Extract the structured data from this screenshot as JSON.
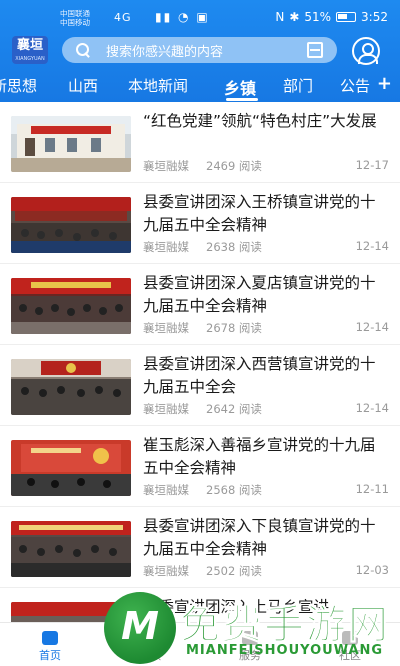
{
  "status_bar": {
    "carrier_line1": "中国联通",
    "carrier_line2": "中国移动",
    "network": "4G",
    "icons": [
      "signal-icon",
      "wifi-icon",
      "message-icon"
    ],
    "battery": "51%",
    "time": "3:52"
  },
  "header": {
    "logo_text": "襄垣",
    "logo_sub": "XIANGYUAN",
    "search_placeholder": "搜索你感兴趣的内容",
    "brand_color": "#1778e3"
  },
  "tabs": [
    {
      "label": "新思想"
    },
    {
      "label": "山西"
    },
    {
      "label": "本地新闻"
    },
    {
      "label": "乡镇",
      "active": true
    },
    {
      "label": "部门"
    },
    {
      "label": "公告"
    }
  ],
  "tab_plus": "+",
  "news": [
    {
      "title": "“红色党建”领航“特色村庄”大发展",
      "source": "襄垣融媒",
      "reads": "2469 阅读",
      "date": "12-17"
    },
    {
      "title": "县委宣讲团深入王桥镇宣讲党的十九届五中全会精神",
      "source": "襄垣融媒",
      "reads": "2638 阅读",
      "date": "12-14"
    },
    {
      "title": "县委宣讲团深入夏店镇宣讲党的十九届五中全会精神",
      "source": "襄垣融媒",
      "reads": "2678 阅读",
      "date": "12-14"
    },
    {
      "title": "县委宣讲团深入西营镇宣讲党的十九届五中全会",
      "source": "襄垣融媒",
      "reads": "2642 阅读",
      "date": "12-14"
    },
    {
      "title": "崔玉彪深入善福乡宣讲党的十九届五中全会精神",
      "source": "襄垣融媒",
      "reads": "2568 阅读",
      "date": "12-11"
    },
    {
      "title": "县委宣讲团深入下良镇宣讲党的十九届五中全会精神",
      "source": "襄垣融媒",
      "reads": "2502 阅读",
      "date": "12-03"
    },
    {
      "title": "县委宣讲团深入上马乡宣讲",
      "source": "",
      "reads": "",
      "date": ""
    }
  ],
  "bottom_nav": [
    {
      "label": "首页",
      "icon": "home-icon",
      "active": true
    },
    {
      "label": "视频",
      "icon": "video-icon"
    },
    {
      "label": "服务",
      "icon": "service-icon"
    },
    {
      "label": "社区",
      "icon": "community-icon"
    }
  ],
  "watermark": {
    "title": "免费手游网",
    "subtitle": "MIANFEISHOUYOUWANG"
  }
}
